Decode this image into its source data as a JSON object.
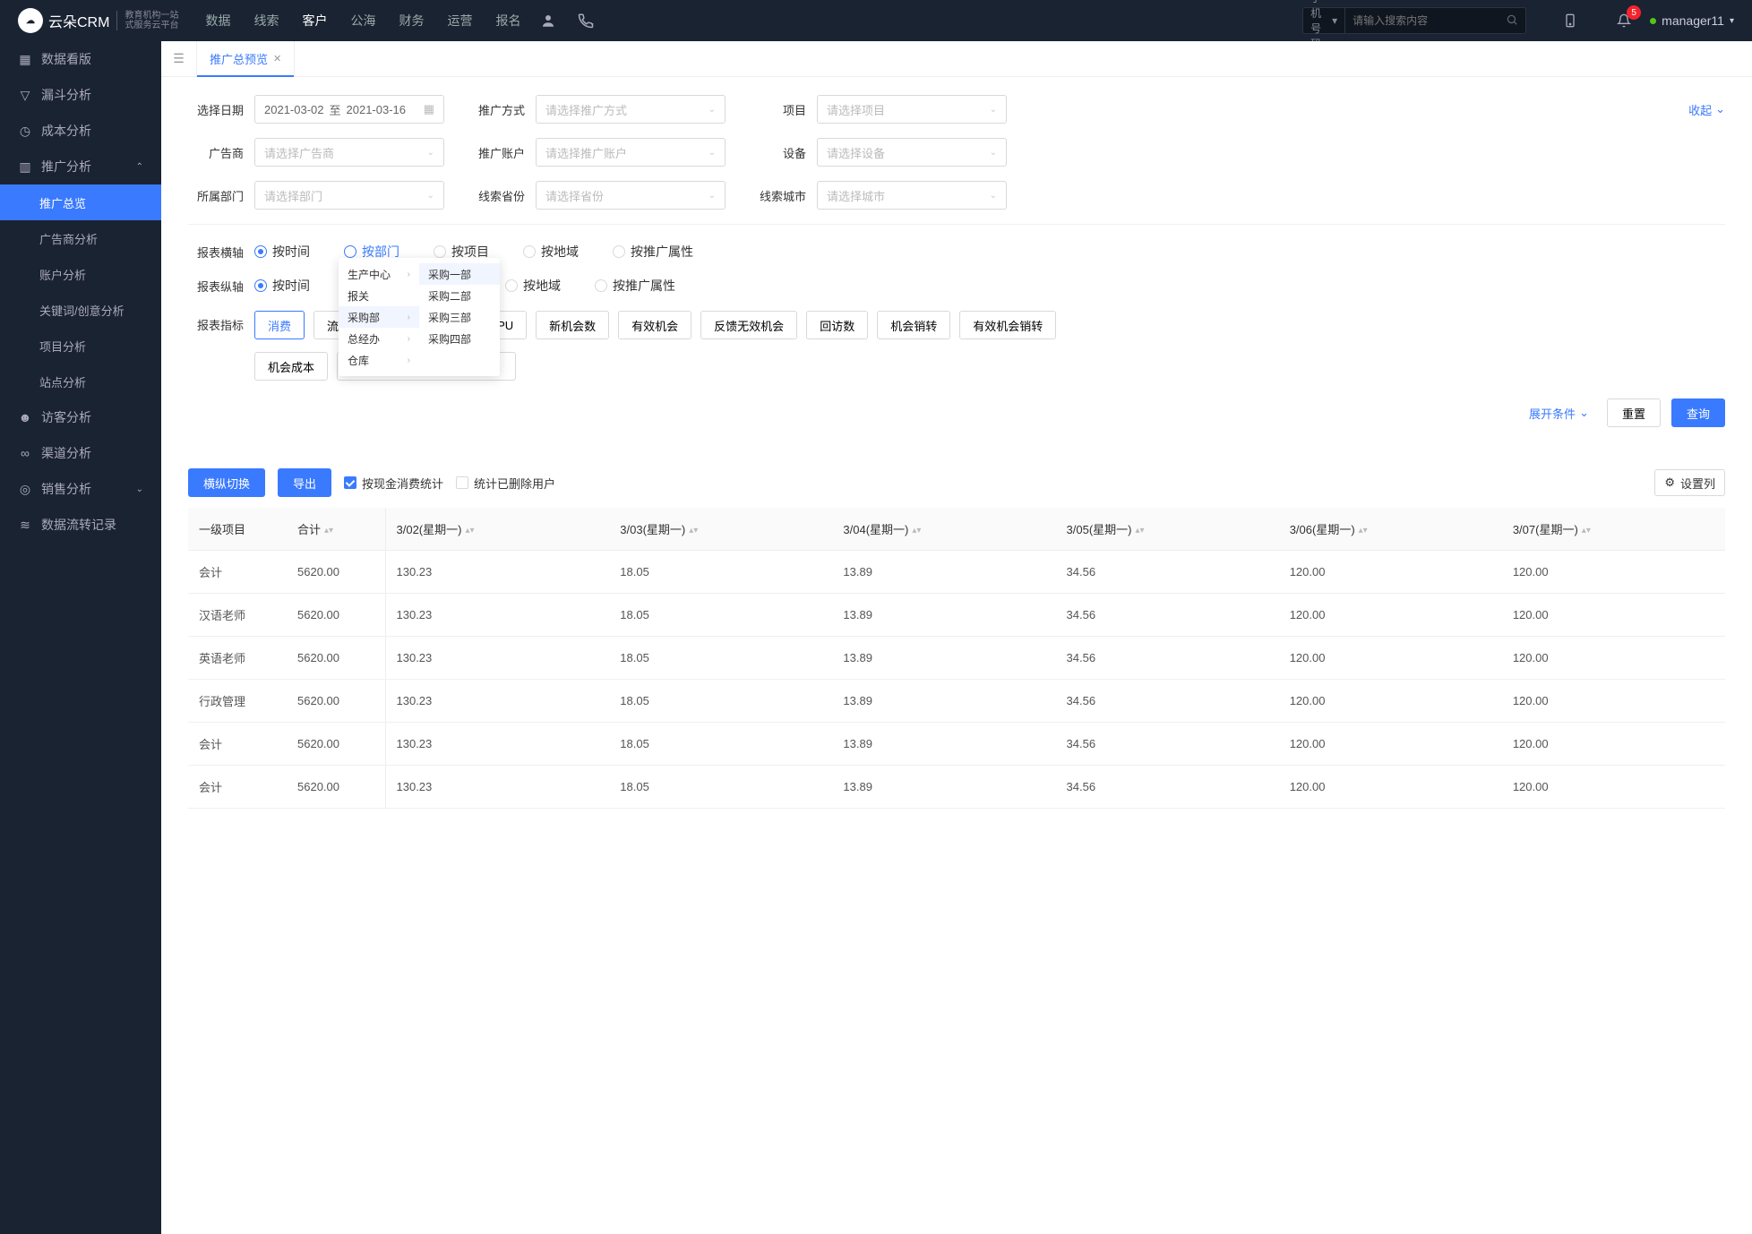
{
  "nav": {
    "items": [
      "数据",
      "线索",
      "客户",
      "公海",
      "财务",
      "运营",
      "报名"
    ],
    "active": 2,
    "search_type": "手机号码",
    "search_placeholder": "请输入搜索内容",
    "badge": "5",
    "user": "manager11"
  },
  "logo": {
    "main": "云朵CRM",
    "sub": "教育机构一站\n式服务云平台"
  },
  "sidebar": {
    "items": [
      {
        "icon": "dashboard",
        "label": "数据看版"
      },
      {
        "icon": "funnel",
        "label": "漏斗分析"
      },
      {
        "icon": "clock",
        "label": "成本分析"
      },
      {
        "icon": "chart",
        "label": "推广分析",
        "open": true,
        "children": [
          {
            "label": "推广总览",
            "active": true
          },
          {
            "label": "广告商分析"
          },
          {
            "label": "账户分析"
          },
          {
            "label": "关键词/创意分析"
          },
          {
            "label": "项目分析"
          },
          {
            "label": "站点分析"
          }
        ]
      },
      {
        "icon": "users",
        "label": "访客分析"
      },
      {
        "icon": "channel",
        "label": "渠道分析"
      },
      {
        "icon": "sales",
        "label": "销售分析",
        "closed": true
      },
      {
        "icon": "flow",
        "label": "数据流转记录"
      }
    ]
  },
  "tab": {
    "label": "推广总预览"
  },
  "filters": {
    "date_label": "选择日期",
    "date_from": "2021-03-02",
    "date_sep": "至",
    "date_to": "2021-03-16",
    "promo_label": "推广方式",
    "promo_ph": "请选择推广方式",
    "project_label": "项目",
    "project_ph": "请选择项目",
    "advertiser_label": "广告商",
    "advertiser_ph": "请选择广告商",
    "account_label": "推广账户",
    "account_ph": "请选择推广账户",
    "device_label": "设备",
    "device_ph": "请选择设备",
    "dept_label": "所属部门",
    "dept_ph": "请选择部门",
    "province_label": "线索省份",
    "province_ph": "请选择省份",
    "city_label": "线索城市",
    "city_ph": "请选择城市",
    "collapse": "收起"
  },
  "axes": {
    "h_label": "报表横轴",
    "v_label": "报表纵轴",
    "options": [
      "按时间",
      "按部门",
      "按项目",
      "按地域",
      "按推广属性"
    ]
  },
  "cascader": {
    "level1": [
      {
        "label": "生产中心",
        "hasChildren": true
      },
      {
        "label": "报关"
      },
      {
        "label": "采购部",
        "hasChildren": true,
        "selected": true
      },
      {
        "label": "总经办",
        "hasChildren": true
      },
      {
        "label": "仓库",
        "hasChildren": true
      }
    ],
    "level2": [
      {
        "label": "采购一部",
        "selected": true
      },
      {
        "label": "采购二部"
      },
      {
        "label": "采购三部"
      },
      {
        "label": "采购四部"
      }
    ]
  },
  "metrics": {
    "label": "报表指标",
    "row1": [
      "消费",
      "流",
      "",
      "",
      "ARPU",
      "新机会数",
      "有效机会",
      "反馈无效机会",
      "回访数",
      "机会销转",
      "有效机会销转"
    ],
    "row2": [
      "机会成本",
      ""
    ]
  },
  "actions": {
    "expand": "展开条件",
    "reset": "重置",
    "query": "查询"
  },
  "toolbar": {
    "switch": "横纵切换",
    "export": "导出",
    "check1": "按现金消费统计",
    "check2": "统计已删除用户",
    "settings": "设置列"
  },
  "table": {
    "header": [
      "一级项目",
      "合计",
      "3/02(星期一)",
      "3/03(星期一)",
      "3/04(星期一)",
      "3/05(星期一)",
      "3/06(星期一)",
      "3/07(星期一)"
    ],
    "rows": [
      [
        "会计",
        "5620.00",
        "130.23",
        "18.05",
        "13.89",
        "34.56",
        "120.00",
        "120.00"
      ],
      [
        "汉语老师",
        "5620.00",
        "130.23",
        "18.05",
        "13.89",
        "34.56",
        "120.00",
        "120.00"
      ],
      [
        "英语老师",
        "5620.00",
        "130.23",
        "18.05",
        "13.89",
        "34.56",
        "120.00",
        "120.00"
      ],
      [
        "行政管理",
        "5620.00",
        "130.23",
        "18.05",
        "13.89",
        "34.56",
        "120.00",
        "120.00"
      ],
      [
        "会计",
        "5620.00",
        "130.23",
        "18.05",
        "13.89",
        "34.56",
        "120.00",
        "120.00"
      ],
      [
        "会计",
        "5620.00",
        "130.23",
        "18.05",
        "13.89",
        "34.56",
        "120.00",
        "120.00"
      ]
    ]
  }
}
